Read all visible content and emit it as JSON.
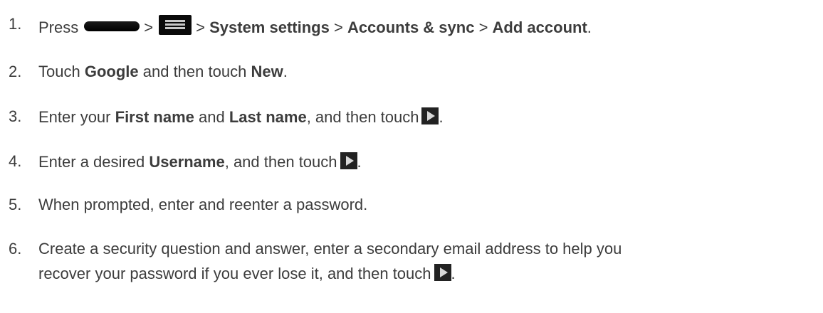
{
  "steps": [
    {
      "number": "1.",
      "parts": {
        "press": "Press",
        "gt1": ">",
        "gt2": ">",
        "system_settings": "System settings",
        "gt3": ">",
        "accounts_sync": "Accounts & sync",
        "gt4": ">",
        "add_account": "Add account",
        "end": "."
      },
      "icons": [
        "home-button-icon",
        "menu-button-icon"
      ]
    },
    {
      "number": "2.",
      "parts": {
        "touch": "Touch",
        "google": "Google",
        "and_then_touch": "and then touch",
        "new": "New",
        "end": "."
      }
    },
    {
      "number": "3.",
      "parts": {
        "enter_your": "Enter your",
        "first_name": "First name",
        "and": "and",
        "last_name": "Last name",
        "and_then_touch": ", and then touch",
        "end": "."
      },
      "icons": [
        "next-arrow-icon"
      ]
    },
    {
      "number": "4.",
      "parts": {
        "enter_desired": "Enter a desired",
        "username": "Username",
        "and_then_touch": ", and then touch",
        "end": "."
      },
      "icons": [
        "next-arrow-icon"
      ]
    },
    {
      "number": "5.",
      "text": "When prompted, enter and reenter a password."
    },
    {
      "number": "6.",
      "line1": "Create a security question and answer, enter a secondary email address to help you",
      "line2": "recover your password if you ever lose it, and then touch",
      "end": "."
    }
  ]
}
